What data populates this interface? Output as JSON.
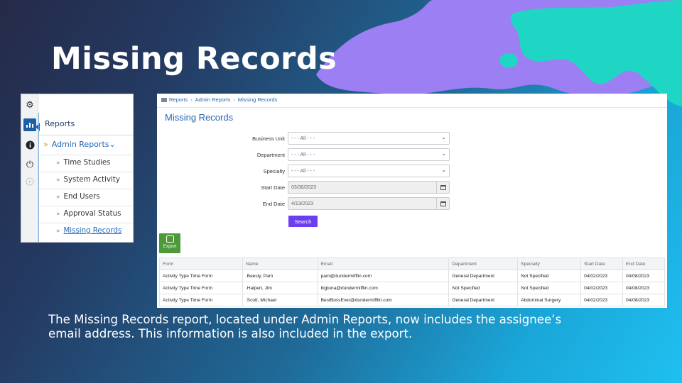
{
  "slide": {
    "title": "Missing Records",
    "caption": "The Missing Records report, located under Admin Reports, now includes the assignee’s email address. This information is also included in the export."
  },
  "colors": {
    "blob_purple": "#9c7ff2",
    "blob_teal": "#1fd6c4",
    "accent_blue": "#2a64b0",
    "search_purple": "#6b3ff0",
    "export_green": "#4e9a3a"
  },
  "sidebar": {
    "rail_icons": [
      "gear-icon",
      "bar-chart-icon",
      "info-icon",
      "power-icon",
      "play-circle-icon"
    ],
    "header": "Reports",
    "parent": {
      "label": "Admin Reports",
      "chevron": "»",
      "expand": "⌄"
    },
    "items": [
      {
        "label": "Time Studies"
      },
      {
        "label": "System Activity"
      },
      {
        "label": "End Users"
      },
      {
        "label": "Approval Status"
      },
      {
        "label": "Missing Records"
      }
    ]
  },
  "breadcrumb": [
    "Reports",
    "Admin Reports",
    "Missing Records"
  ],
  "report": {
    "title": "Missing Records",
    "filters": [
      {
        "label": "Business Unit",
        "value": "- - - All - - -",
        "kind": "select"
      },
      {
        "label": "Department",
        "value": "- - - All - - -",
        "kind": "select"
      },
      {
        "label": "Specialty",
        "value": "- - - All - - -",
        "kind": "select"
      },
      {
        "label": "Start Date",
        "value": "03/30/2023",
        "kind": "date"
      },
      {
        "label": "End Date",
        "value": "4/13/2023",
        "kind": "date"
      }
    ],
    "search_label": "Search",
    "export_label": "Export"
  },
  "table": {
    "columns": [
      "Form",
      "Name",
      "Email",
      "Department",
      "Specialty",
      "Start Date",
      "End Date"
    ],
    "rows": [
      [
        "Activity Type Time Form",
        ".Beesly, Pam",
        "pam@dundermifflin.com",
        "General Department",
        "Not Specified",
        "04/02/2023",
        "04/08/2023"
      ],
      [
        "Activity Type Time Form",
        ".Halpert, Jim",
        "bigtuna@dundermifflin.com",
        "Not Specified",
        "Not Specified",
        "04/02/2023",
        "04/08/2023"
      ],
      [
        "Activity Type Time Form",
        ".Scott, Michael",
        "BestBossEver@dundermifflin.com",
        "General Department",
        "Abdominal Surgery",
        "04/02/2023",
        "04/08/2023"
      ]
    ]
  }
}
